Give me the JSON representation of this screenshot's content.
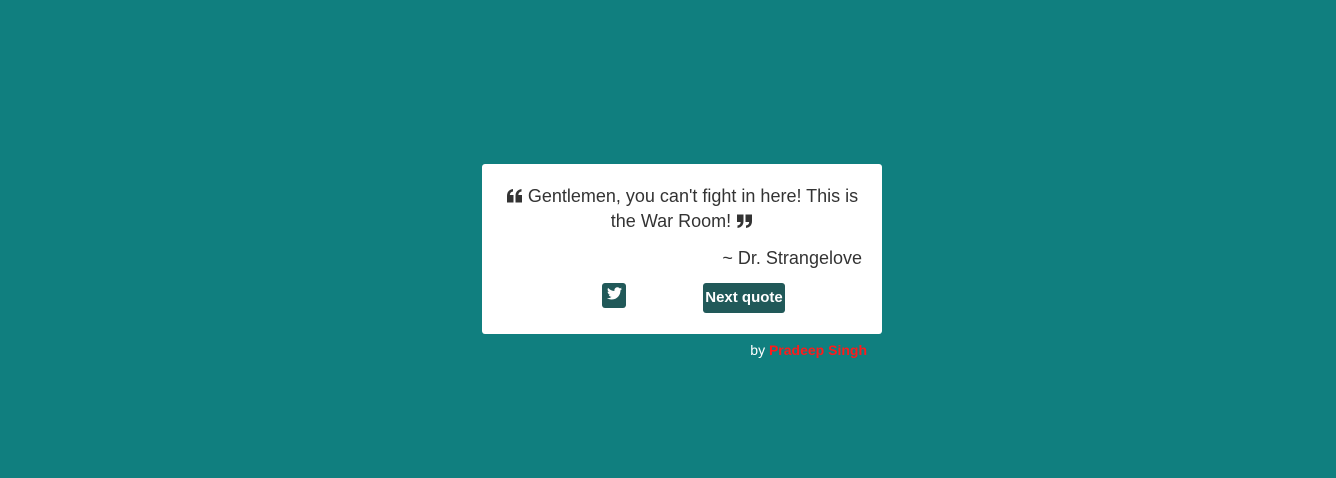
{
  "colors": {
    "background": "#107f7f",
    "card": "#ffffff",
    "button": "#215959",
    "text": "#333333",
    "link": "#ff1a1a"
  },
  "quote": {
    "open_icon": "quote-left-icon",
    "text": "Gentlemen, you can't fight in here! This is the War Room!",
    "close_icon": "quote-right-icon",
    "author": "~ Dr. Strangelove"
  },
  "actions": {
    "tweet_icon": "twitter-icon",
    "next_label": "Next quote"
  },
  "credit": {
    "prefix": "by",
    "name": "Pradeep Singh"
  }
}
